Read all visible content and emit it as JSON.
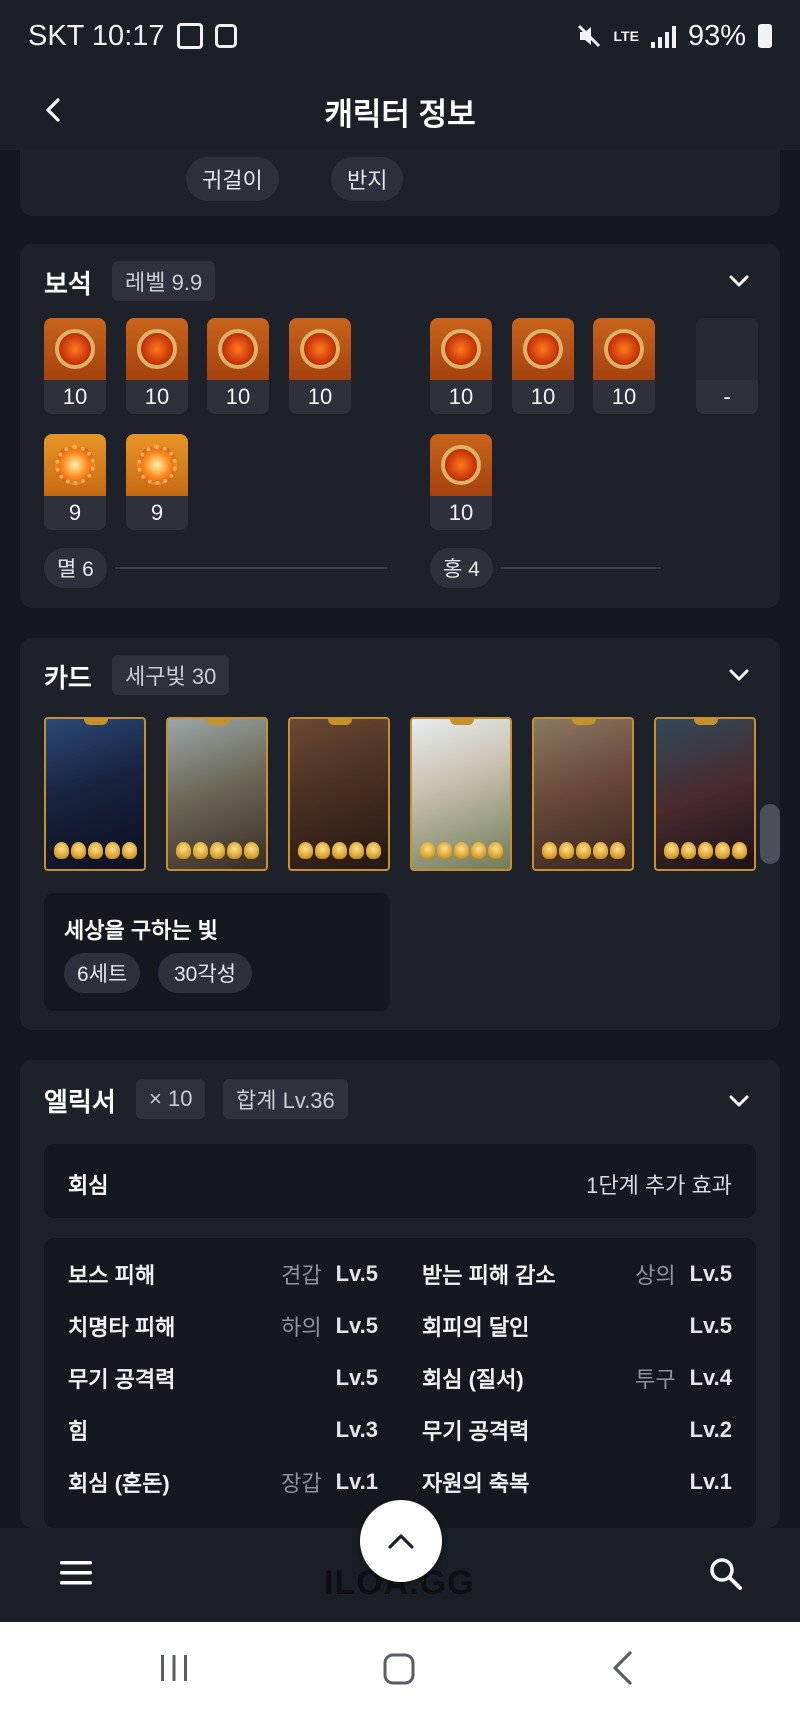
{
  "status_bar": {
    "carrier_time": "SKT 10:17",
    "network": "LTE",
    "battery": "93%"
  },
  "header": {
    "title": "캐릭터 정보"
  },
  "accessories": {
    "chips": [
      "귀걸이",
      "반지"
    ]
  },
  "gems": {
    "title": "보석",
    "level_tag": "레벨 9.9",
    "left_group": {
      "row1": [
        "10",
        "10",
        "10",
        "10"
      ],
      "row2": [
        "9",
        "9"
      ],
      "summary": "멸 6"
    },
    "right_group": {
      "row1": [
        "10",
        "10",
        "10",
        "-"
      ],
      "row2": [
        "10"
      ],
      "summary": "홍 4"
    },
    "colors": {
      "accent": "#e07a1f"
    }
  },
  "cards": {
    "title": "카드",
    "tag": "세구빛 30",
    "card_count": 6,
    "stars_each": 5,
    "set_name": "세상을 구하는 빛",
    "set_chips": [
      "6세트",
      "30각성"
    ]
  },
  "elixir": {
    "title": "엘릭서",
    "tag_count": "× 10",
    "tag_total": "합계 Lv.36",
    "effect_row": {
      "name": "회심",
      "value": "1단계 추가 효과"
    },
    "stats_left": [
      {
        "name": "보스 피해",
        "part": "견갑",
        "level": "Lv.5"
      },
      {
        "name": "치명타 피해",
        "part": "하의",
        "level": "Lv.5"
      },
      {
        "name": "무기 공격력",
        "part": "",
        "level": "Lv.5"
      },
      {
        "name": "힘",
        "part": "",
        "level": "Lv.3"
      },
      {
        "name": "회심 (혼돈)",
        "part": "장갑",
        "level": "Lv.1"
      }
    ],
    "stats_right": [
      {
        "name": "받는 피해 감소",
        "part": "상의",
        "level": "Lv.5"
      },
      {
        "name": "회피의 달인",
        "part": "",
        "level": "Lv.5"
      },
      {
        "name": "회심 (질서)",
        "part": "투구",
        "level": "Lv.4"
      },
      {
        "name": "무기 공격력",
        "part": "",
        "level": "Lv.2"
      },
      {
        "name": "자원의 축복",
        "part": "",
        "level": "Lv.1"
      }
    ]
  },
  "bottom_bar": {
    "logo": "ILOA.GG"
  }
}
